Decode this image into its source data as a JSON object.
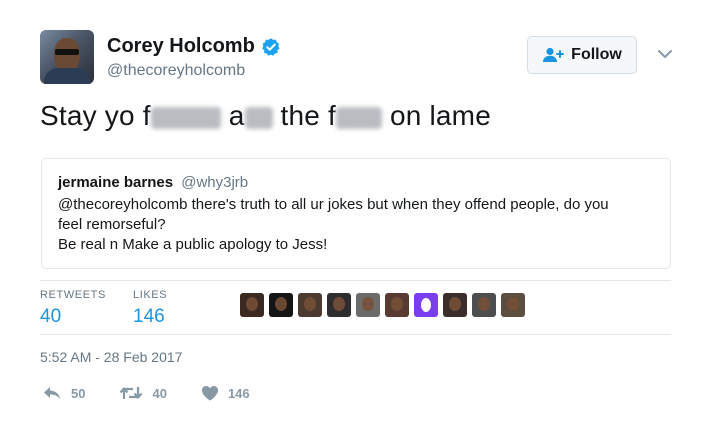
{
  "user": {
    "display_name": "Corey Holcomb",
    "handle": "@thecoreyholcomb",
    "verified": true
  },
  "follow_button": {
    "label": "Follow"
  },
  "tweet": {
    "text_parts": [
      "Stay yo f",
      "a",
      "the f",
      "on lame"
    ]
  },
  "quoted_tweet": {
    "display_name": "jermaine barnes",
    "handle": "@why3jrb",
    "text_line1": "@thecoreyholcomb there's truth to all ur jokes but when they offend people, do you",
    "text_line2": "feel remorseful?",
    "text_line3": "Be real n Make a public apology to Jess!"
  },
  "stats": {
    "retweets_label": "RETWEETS",
    "retweets_value": "40",
    "likes_label": "LIKES",
    "likes_value": "146"
  },
  "likers": [
    "#3b2a22",
    "#151515",
    "#4a3a30",
    "#2e2e2e",
    "#6b6b6b",
    "#5a3b33",
    "#7a3ef0",
    "#3a2f2a",
    "#4e4e4e",
    "#5b4d40"
  ],
  "timestamp": "5:52 AM - 28 Feb 2017",
  "actions": {
    "reply_count": "50",
    "retweet_count": "40",
    "like_count": "146"
  },
  "colors": {
    "accent": "#1b95e0",
    "verified": "#1da1f2",
    "muted": "#657786"
  }
}
